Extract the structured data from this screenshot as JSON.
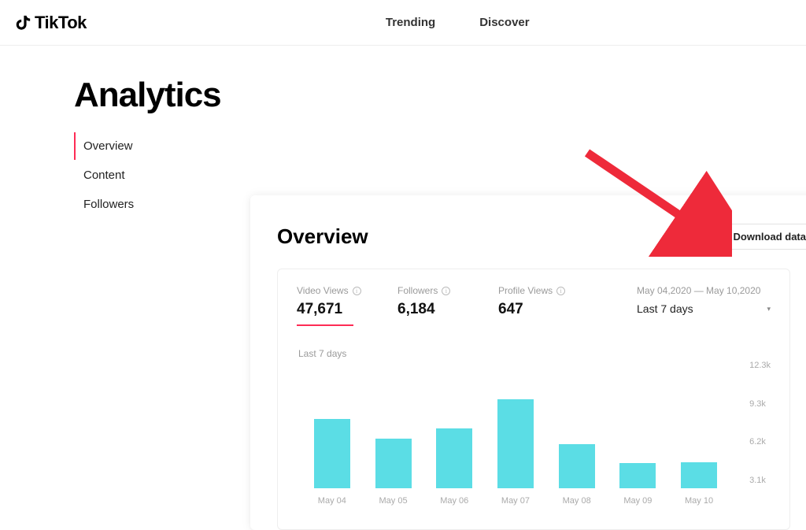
{
  "brand": "TikTok",
  "nav": {
    "trending": "Trending",
    "discover": "Discover"
  },
  "page_title": "Analytics",
  "sidebar": {
    "items": [
      {
        "label": "Overview",
        "active": true
      },
      {
        "label": "Content",
        "active": false
      },
      {
        "label": "Followers",
        "active": false
      }
    ]
  },
  "panel": {
    "title": "Overview",
    "download_label": "Download data",
    "metrics": [
      {
        "label": "Video Views",
        "value": "47,671",
        "active": true
      },
      {
        "label": "Followers",
        "value": "6,184",
        "active": false
      },
      {
        "label": "Profile Views",
        "value": "647",
        "active": false
      }
    ],
    "date_range_text": "May 04,2020 — May 10,2020",
    "date_select_label": "Last 7 days",
    "chart_subtitle": "Last 7 days"
  },
  "chart_data": {
    "type": "bar",
    "title": "Video Views — Last 7 days",
    "xlabel": "",
    "ylabel": "",
    "ylim": [
      0,
      12300
    ],
    "yticks": [
      "12.3k",
      "9.3k",
      "6.2k",
      "3.1k"
    ],
    "categories": [
      "May 04",
      "May 05",
      "May 06",
      "May 07",
      "May 08",
      "May 09",
      "May 10"
    ],
    "values": [
      7200,
      5200,
      6200,
      9300,
      4600,
      2600,
      2700
    ]
  },
  "colors": {
    "accent": "#fe2c55",
    "bar": "#5bdde5"
  }
}
